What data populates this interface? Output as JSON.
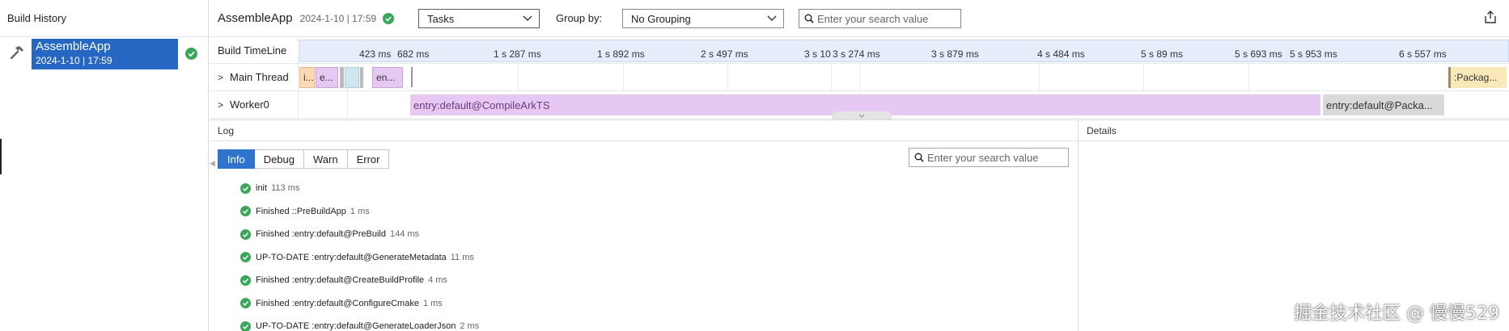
{
  "sidebar": {
    "title": "Build History",
    "item": {
      "name": "AssembleApp",
      "time": "2024-1-10 | 17:59"
    }
  },
  "topbar": {
    "app_name": "AssembleApp",
    "app_time": "2024-1-10 | 17:59",
    "view_select": "Tasks",
    "group_by_label": "Group by:",
    "grouping_select": "No Grouping",
    "search_placeholder": "Enter your search value"
  },
  "timeline": {
    "header_label": "Build TimeLine",
    "ticks": [
      "423 ms",
      "682 ms",
      "1 s 287 ms",
      "1 s 892 ms",
      "2 s 497 ms",
      "3 s 10",
      "3 s 274 ms",
      "3 s 879 ms",
      "4 s 484 ms",
      "5 s 89 ms",
      "5 s 693 ms",
      "5 s 953 ms",
      "6 s 557 ms"
    ],
    "rows": [
      {
        "name": "Main Thread",
        "bars": [
          "i...",
          "e...",
          "",
          "",
          "",
          "en...",
          ":Packag..."
        ]
      },
      {
        "name": "Worker0",
        "bars": [
          "entry:default@CompileArkTS",
          "entry:default@Packa..."
        ]
      }
    ]
  },
  "log": {
    "title": "Log",
    "tabs": [
      "Info",
      "Debug",
      "Warn",
      "Error"
    ],
    "active_tab": "Info",
    "search_placeholder": "Enter your search value",
    "entries": [
      {
        "text": "init",
        "duration": "113 ms"
      },
      {
        "text": "Finished ::PreBuildApp",
        "duration": "1 ms"
      },
      {
        "text": "Finished :entry:default@PreBuild",
        "duration": "144 ms"
      },
      {
        "text": "UP-TO-DATE :entry:default@GenerateMetadata",
        "duration": "11 ms"
      },
      {
        "text": "Finished :entry:default@CreateBuildProfile",
        "duration": "4 ms"
      },
      {
        "text": "Finished :entry:default@ConfigureCmake",
        "duration": "1 ms"
      },
      {
        "text": "UP-TO-DATE :entry:default@GenerateLoaderJson",
        "duration": "2 ms"
      }
    ]
  },
  "details": {
    "title": "Details"
  },
  "watermark": "掘金技术社区 @ 慢慢529",
  "colors": {
    "accent": "#2767c4",
    "success": "#3aa657",
    "timeline_axis": "#e6eefc",
    "bar_purple": "#e7c8f2",
    "bar_peach": "#fcd9b4",
    "bar_gray": "#d9d9d9",
    "bar_yellow": "#fbe8b8"
  }
}
